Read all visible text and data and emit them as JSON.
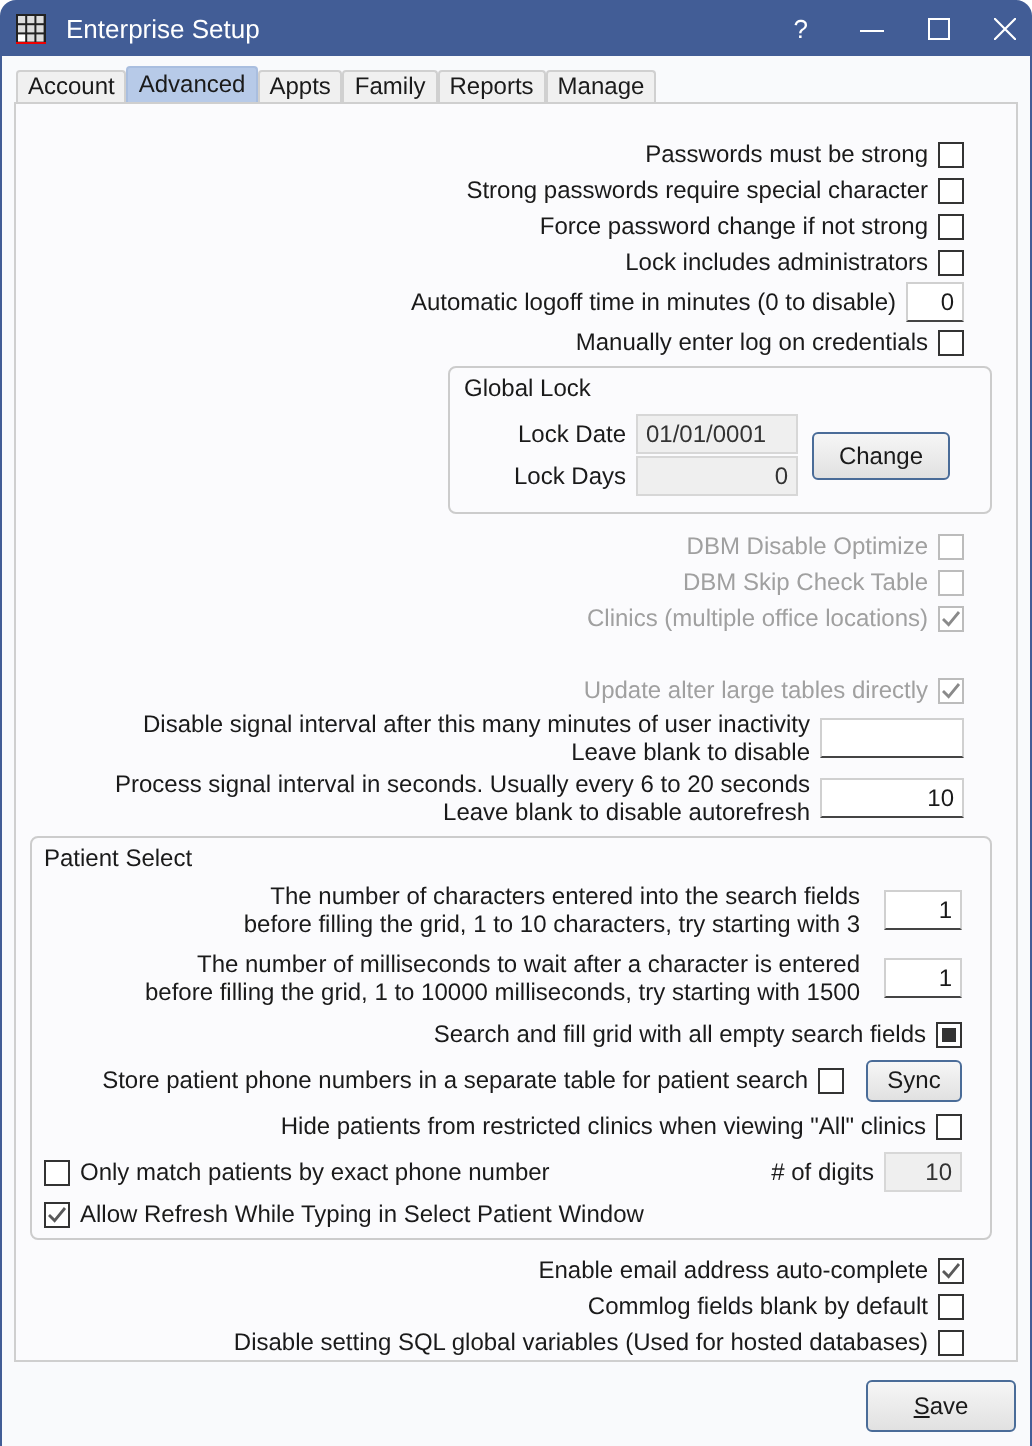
{
  "window": {
    "title": "Enterprise Setup",
    "help": "?"
  },
  "tabs": [
    {
      "label": "Account",
      "selected": false
    },
    {
      "label": "Advanced",
      "selected": true
    },
    {
      "label": "Appts",
      "selected": false
    },
    {
      "label": "Family",
      "selected": false
    },
    {
      "label": "Reports",
      "selected": false
    },
    {
      "label": "Manage",
      "selected": false
    }
  ],
  "top_settings": [
    {
      "kind": "checkbox",
      "label": "Passwords must be strong",
      "checked": false,
      "disabled": false
    },
    {
      "kind": "checkbox",
      "label": "Strong passwords require special character",
      "checked": false,
      "disabled": false
    },
    {
      "kind": "checkbox",
      "label": "Force password change if not strong",
      "checked": false,
      "disabled": false
    },
    {
      "kind": "checkbox",
      "label": "Lock includes administrators",
      "checked": false,
      "disabled": false
    },
    {
      "kind": "number",
      "label": "Automatic logoff time in minutes (0 to disable)",
      "value": "0",
      "disabled": false
    },
    {
      "kind": "checkbox",
      "label": "Manually enter log on credentials",
      "checked": false,
      "disabled": false
    }
  ],
  "global_lock": {
    "title": "Global Lock",
    "fields": [
      {
        "label": "Lock Date",
        "value": "01/01/0001",
        "kind": "date"
      },
      {
        "label": "Lock Days",
        "value": "0",
        "kind": "number"
      }
    ],
    "button": "Change"
  },
  "database_settings": [
    {
      "kind": "checkbox",
      "label": "DBM Disable Optimize",
      "checked": false,
      "disabled": true
    },
    {
      "kind": "checkbox",
      "label": "DBM Skip Check Table",
      "checked": false,
      "disabled": true
    },
    {
      "kind": "checkbox",
      "label": "Clinics (multiple office locations)",
      "checked": true,
      "disabled": true
    }
  ],
  "update_settings": [
    {
      "kind": "checkbox",
      "label": "Update alter large tables directly",
      "checked": true,
      "disabled": true
    },
    {
      "kind": "number",
      "lines": [
        "Disable signal interval after this many minutes of user inactivity",
        "Leave blank to disable"
      ],
      "disabled": false
    },
    {
      "kind": "number",
      "lines": [
        "Process signal interval in seconds. Usually every 6 to 20 seconds",
        "Leave blank to disable autorefresh"
      ],
      "value": "10",
      "disabled": false
    }
  ],
  "patient_select": {
    "title": "Patient Select",
    "rows": [
      {
        "kind": "number",
        "lines": [
          "The number of characters entered into the search fields",
          "before filling the grid, 1 to 10 characters, try starting with 3"
        ],
        "value": "1"
      },
      {
        "kind": "number",
        "lines": [
          "The number of milliseconds to wait after a character is entered",
          "before filling the grid, 1 to 10000 milliseconds, try starting with 1500"
        ],
        "value": "1"
      },
      {
        "kind": "checkbox",
        "label": "Search and fill grid with all empty search fields",
        "checked": false,
        "indeterminate": true
      },
      {
        "kind": "checkbox_button",
        "label": "Store patient phone numbers in a separate table for patient search",
        "checked": false,
        "indeterminate": false,
        "button": "Sync"
      },
      {
        "kind": "checkbox",
        "label": "Hide patients from restricted clinics when viewing \"All\" clinics",
        "checked": false,
        "indeterminate": false
      },
      {
        "kind": "left_checkbox_field",
        "label": "Only match patients by exact phone number",
        "checked": false,
        "indeterminate": false,
        "field_label": "# of digits",
        "field_value": "10"
      },
      {
        "kind": "left_checkbox",
        "label": "Allow Refresh While Typing in Select Patient Window",
        "checked": true,
        "indeterminate": false
      }
    ]
  },
  "bottom_settings": [
    {
      "kind": "checkbox",
      "label": "Enable email address auto-complete",
      "checked": true,
      "disabled": false
    },
    {
      "kind": "checkbox",
      "label": "Commlog fields blank by default",
      "checked": false,
      "disabled": false
    },
    {
      "kind": "checkbox",
      "label": "Disable setting SQL global variables (Used for hosted databases)",
      "checked": false,
      "disabled": false
    }
  ],
  "save_button": {
    "label": "Save",
    "mnemonic_underlined": true
  }
}
